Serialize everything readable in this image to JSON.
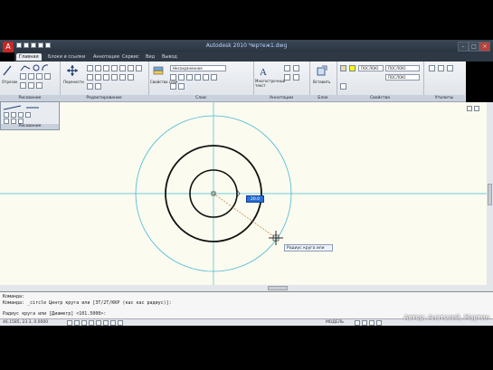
{
  "window": {
    "title": "Autodesk 2010 Чертеж1.dwg",
    "app_button": "A",
    "controls": [
      "–",
      "□",
      "×"
    ]
  },
  "tabs": [
    {
      "label": "Главная",
      "active": true
    },
    {
      "label": "Блоки и ссылки",
      "active": false
    },
    {
      "label": "Аннотации",
      "active": false
    },
    {
      "label": "Сервис",
      "active": false
    },
    {
      "label": "Вид",
      "active": false
    },
    {
      "label": "Вывод",
      "active": false
    }
  ],
  "ribbon": {
    "panels": [
      {
        "label": "Рисование",
        "buttons": [
          "Отрезок",
          "Полилиния",
          "Круг",
          "Дуга"
        ]
      },
      {
        "label": "Редактирование",
        "buttons": [
          "Перенести"
        ]
      },
      {
        "label": "Слои",
        "dropdown": "Несохраненное",
        "buttons": [
          "Свойства слоя"
        ]
      },
      {
        "label": "Аннотации",
        "buttons": [
          "Многострочный текст"
        ]
      },
      {
        "label": "Блок",
        "buttons": [
          "Вставить"
        ]
      },
      {
        "label": "Свойства",
        "dropdowns": [
          "ПОСЛОЮ",
          "ПОСЛОЮ",
          "ПОСЛОЮ"
        ]
      },
      {
        "label": "Утилиты",
        "buttons": [
          "Измерить"
        ]
      }
    ],
    "flyout_label": "Рисование"
  },
  "drawing": {
    "dynamic_input_value": "20.0",
    "tooltip": "Радиус круга или",
    "colors": {
      "background": "#fbfbef",
      "centerline": "#46b8d4",
      "geometry": "#111111",
      "rubberband": "#c06010"
    }
  },
  "command_window": {
    "lines": [
      "Команда:",
      "Команда: _circle Центр круга или [3Т/2Т/ККР (кас кас радиус)]:",
      "Радиус круга или [Диаметр] <101.5000>:"
    ]
  },
  "status_bar": {
    "coords": "46.1585, 23.3, 0.0000",
    "model": "МОДЕЛЬ"
  },
  "credit": "Автор: Анатолий, Мартин"
}
